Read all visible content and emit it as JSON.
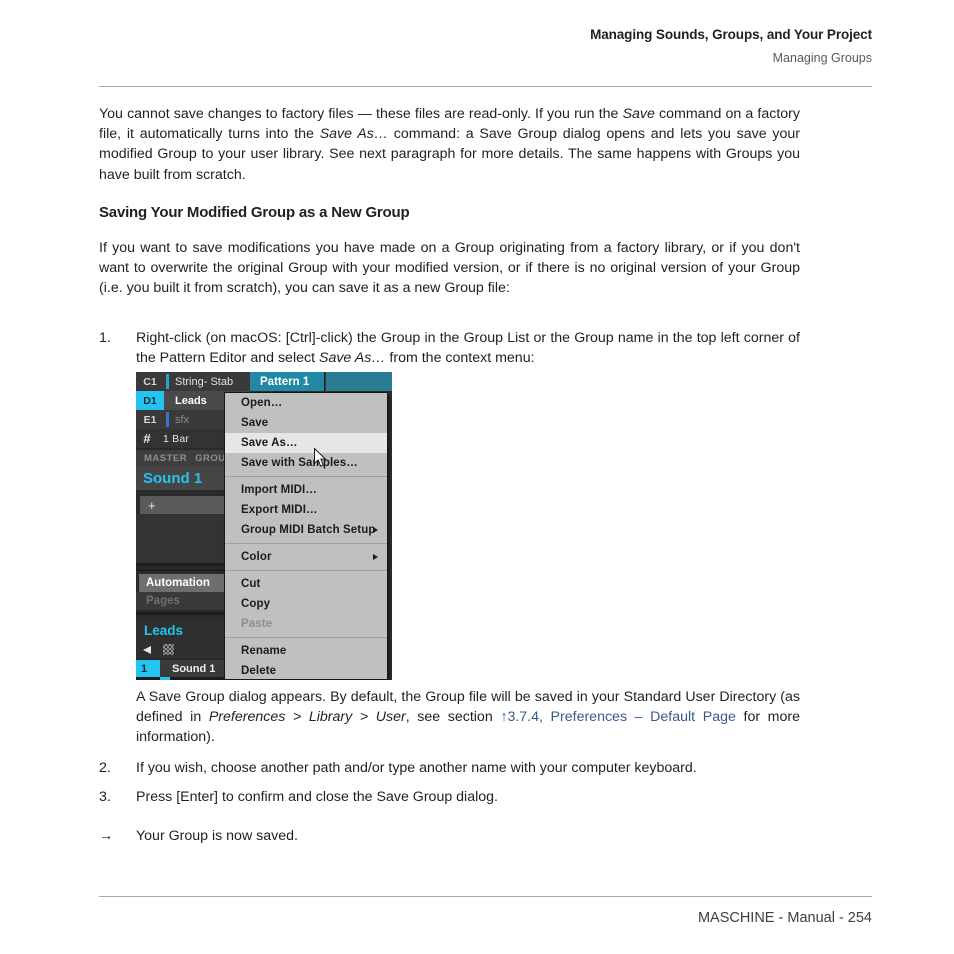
{
  "header": {
    "title": "Managing Sounds, Groups, and Your Project",
    "subtitle": "Managing Groups"
  },
  "intro_paragraph": {
    "part1": "You cannot save changes to factory files — these files are read-only. If you run the ",
    "em1": "Save",
    "part2": " command on a factory file, it automatically turns into the ",
    "em2": "Save As…",
    "part3": " command: a Save Group dialog opens and lets you save your modified Group to your user library. See next paragraph for more details. The same happens with Groups you have built from scratch."
  },
  "section": {
    "heading": "Saving Your Modified Group as a New Group",
    "paragraph": "If you want to save modifications you have made on a Group originating from a factory library, or if you don't want to overwrite the original Group with your modified version, or if there is no original version of your Group (i.e. you built it from scratch), you can save it as a new Group file:"
  },
  "steps": [
    {
      "number": "1.",
      "part1": "Right-click (on macOS: [Ctrl]-click) the Group in the Group List or the Group name in the top left corner of the Pattern Editor and select ",
      "em1": "Save As…",
      "part2": " from the context menu:"
    },
    {
      "number": "2.",
      "text": "If you wish, choose another path and/or type another name with your computer keyboard."
    },
    {
      "number": "3.",
      "text": "Press [Enter] to confirm and close the Save Group dialog."
    }
  ],
  "caption": {
    "part1": "A Save Group dialog appears. By default, the Group file will be saved in your Standard User Directory (as defined in ",
    "em1": "Preferences > Library > User",
    "part2": ", see section ",
    "link": "↑3.7.4, Preferences – Default Page",
    "part3": " for more information)."
  },
  "result": {
    "arrow": "→",
    "text": "Your Group is now saved."
  },
  "footer": {
    "text": "MASCHINE - Manual - 254"
  },
  "screenshot": {
    "pads": [
      {
        "key": "C1",
        "name": "String- Stab",
        "bar_color": "#22a7c9"
      },
      {
        "key": "D1",
        "name": "Leads",
        "bar_color": ""
      },
      {
        "key": "E1",
        "name": "sfx",
        "bar_color": "#3d6fd0"
      }
    ],
    "bar_length": "1 Bar",
    "hash_icon": "#",
    "tabs": [
      "MASTER",
      "GROU"
    ],
    "sound_label": "Sound 1",
    "plus_icon": "+",
    "automation_label": "Automation",
    "pages_label": "Pages",
    "group_name": "Leads",
    "speaker_icon": "speaker-icon",
    "grid_icon": "grid-icon",
    "sound_slot": {
      "number": "1",
      "name": "Sound 1"
    },
    "pattern": {
      "label": "Pattern 1"
    },
    "context_menu": [
      {
        "label": "Open…",
        "state": "normal",
        "submenu": false
      },
      {
        "label": "Save",
        "state": "normal",
        "submenu": false
      },
      {
        "label": "Save As…",
        "state": "highlighted",
        "submenu": false
      },
      {
        "label": "Save with Samples…",
        "state": "normal",
        "submenu": false
      },
      {
        "label": "Import MIDI…",
        "state": "normal",
        "submenu": false
      },
      {
        "label": "Export MIDI…",
        "state": "normal",
        "submenu": false
      },
      {
        "label": "Group MIDI Batch Setup",
        "state": "normal",
        "submenu": true
      },
      {
        "label": "Color",
        "state": "normal",
        "submenu": true
      },
      {
        "label": "Cut",
        "state": "normal",
        "submenu": false
      },
      {
        "label": "Copy",
        "state": "normal",
        "submenu": false
      },
      {
        "label": "Paste",
        "state": "disabled",
        "submenu": false
      },
      {
        "label": "Rename",
        "state": "normal",
        "submenu": false
      },
      {
        "label": "Delete",
        "state": "normal",
        "submenu": false
      }
    ]
  },
  "colors": {
    "accent_cyan": "#25c3f0",
    "accent_teal": "#2188a5",
    "link_blue": "#39598f",
    "text": "#231f20",
    "rule": "#a9a9a9"
  }
}
